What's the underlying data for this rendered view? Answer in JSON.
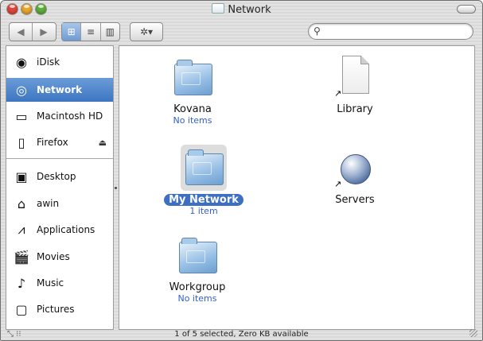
{
  "window": {
    "title": "Network"
  },
  "toolbar": {
    "back_glyph": "◀",
    "forward_glyph": "▶",
    "view_icon_glyph": "⊞",
    "view_list_glyph": "≡",
    "view_column_glyph": "▥",
    "action_glyph": "✲▾",
    "search_glyph": "⚲",
    "search_value": ""
  },
  "sidebar": {
    "items": [
      {
        "label": "iDisk",
        "icon": "idisk-icon",
        "glyph": "◉",
        "selected": false
      },
      {
        "label": "Network",
        "icon": "network-globe-icon",
        "glyph": "◎",
        "selected": true
      },
      {
        "label": "Macintosh HD",
        "icon": "hard-drive-icon",
        "glyph": "▭",
        "selected": false
      },
      {
        "label": "Firefox",
        "icon": "disk-image-icon",
        "glyph": "▯",
        "selected": false,
        "eject": "⏏"
      },
      {
        "label": "Desktop",
        "icon": "desktop-icon",
        "glyph": "▣",
        "selected": false
      },
      {
        "label": "awin",
        "icon": "home-icon",
        "glyph": "⌂",
        "selected": false
      },
      {
        "label": "Applications",
        "icon": "applications-icon",
        "glyph": "⩘",
        "selected": false
      },
      {
        "label": "Movies",
        "icon": "movies-icon",
        "glyph": "🎬",
        "selected": false
      },
      {
        "label": "Music",
        "icon": "music-icon",
        "glyph": "♪",
        "selected": false
      },
      {
        "label": "Pictures",
        "icon": "pictures-icon",
        "glyph": "▢",
        "selected": false
      }
    ]
  },
  "content": {
    "items": [
      {
        "name": "Kovana",
        "sub": "No items",
        "type": "folder"
      },
      {
        "name": "Library",
        "sub": "",
        "type": "alias-document"
      },
      {
        "name": "My Network",
        "sub": "1 item",
        "type": "folder",
        "selected": true
      },
      {
        "name": "Servers",
        "sub": "",
        "type": "alias-globe"
      },
      {
        "name": "Workgroup",
        "sub": "No items",
        "type": "folder"
      }
    ],
    "alias_arrow": "↗"
  },
  "status": {
    "text": "1 of 5 selected, Zero KB available",
    "grip": "⤡ ⁝⁝"
  },
  "colors": {
    "selection": "#3d75c2",
    "subtitle": "#2f5fd0"
  }
}
